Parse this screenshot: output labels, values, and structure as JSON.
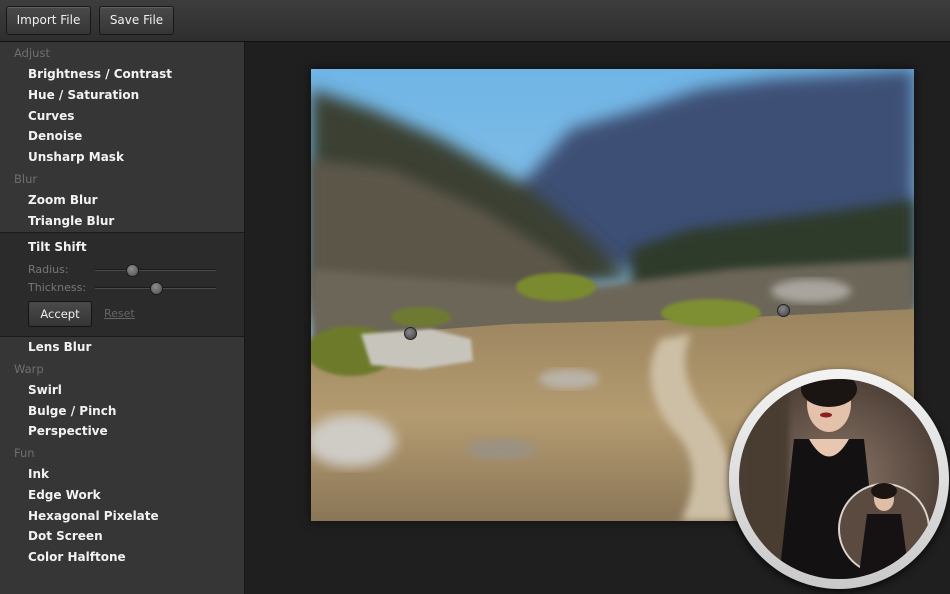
{
  "toolbar": {
    "import_label": "Import File",
    "save_label": "Save File"
  },
  "sidebar": {
    "adjust": {
      "header": "Adjust",
      "items": [
        "Brightness / Contrast",
        "Hue / Saturation",
        "Curves",
        "Denoise",
        "Unsharp Mask"
      ]
    },
    "blur": {
      "header": "Blur",
      "items": [
        "Zoom Blur",
        "Triangle Blur",
        "Tilt Shift",
        "Lens Blur"
      ]
    },
    "tilt_shift_panel": {
      "title": "Tilt Shift",
      "radius_label": "Radius:",
      "thickness_label": "Thickness:",
      "radius_level": 0.3,
      "thickness_level": 0.5,
      "accept_label": "Accept",
      "reset_label": "Reset"
    },
    "warp": {
      "header": "Warp",
      "items": [
        "Swirl",
        "Bulge / Pinch",
        "Perspective"
      ]
    },
    "fun": {
      "header": "Fun",
      "items": [
        "Ink",
        "Edge Work",
        "Hexagonal Pixelate",
        "Dot Screen",
        "Color Halftone"
      ]
    }
  },
  "colors": {
    "sidebar_bg": "#363636",
    "panel_bg": "#2b2b2b",
    "workspace_bg": "#1f1f1f",
    "text": "#f2f2f2",
    "section_text": "#6f6f6f"
  },
  "icons": {
    "app_badge": "layered-portrait-app-icon"
  }
}
